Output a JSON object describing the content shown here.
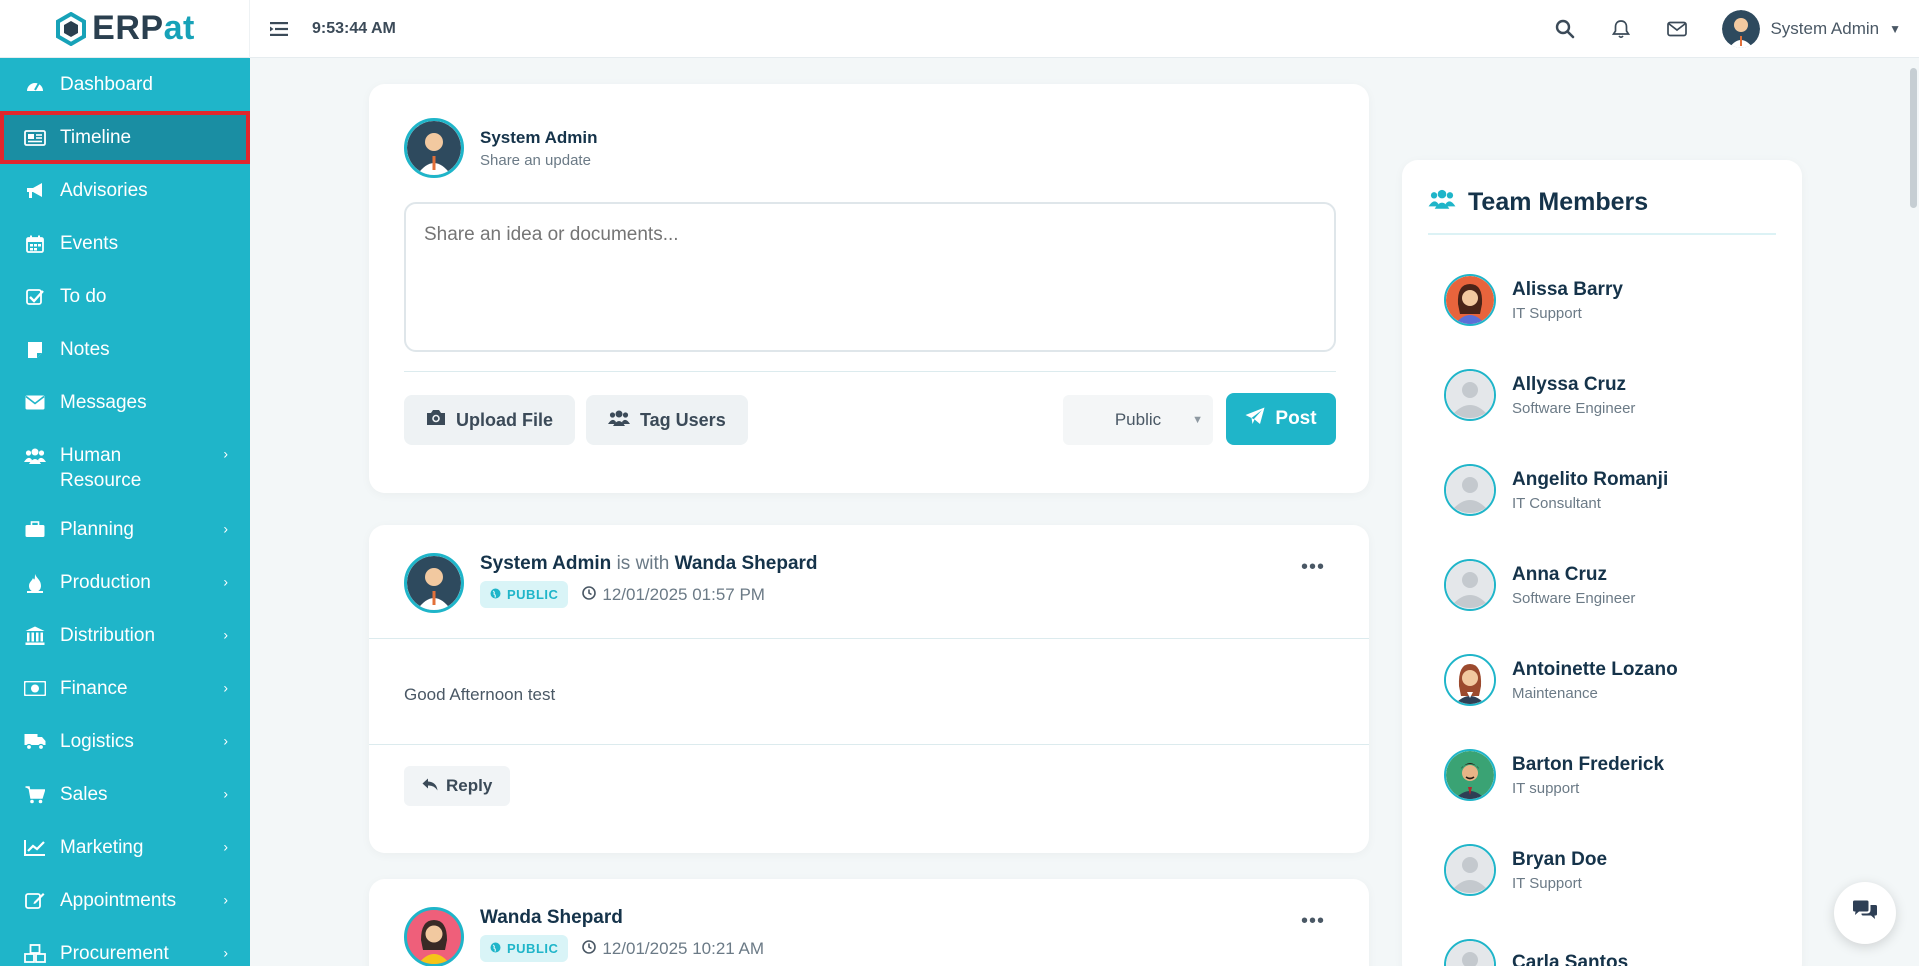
{
  "brand": {
    "prefix": "ERP",
    "suffix": "at"
  },
  "header": {
    "clock": "9:53:44 AM",
    "user_name": "System Admin"
  },
  "sidebar": {
    "items": [
      {
        "label": "Dashboard",
        "icon": "dashboard-icon",
        "has_submenu": false
      },
      {
        "label": "Timeline",
        "icon": "timeline-icon",
        "has_submenu": false,
        "active": true
      },
      {
        "label": "Advisories",
        "icon": "bullhorn-icon",
        "has_submenu": false
      },
      {
        "label": "Events",
        "icon": "calendar-icon",
        "has_submenu": false
      },
      {
        "label": "To do",
        "icon": "check-square-icon",
        "has_submenu": false
      },
      {
        "label": "Notes",
        "icon": "note-icon",
        "has_submenu": false
      },
      {
        "label": "Messages",
        "icon": "envelope-icon",
        "has_submenu": false
      },
      {
        "label": "Human Resource",
        "icon": "users-icon",
        "has_submenu": true
      },
      {
        "label": "Planning",
        "icon": "briefcase-icon",
        "has_submenu": true
      },
      {
        "label": "Production",
        "icon": "fire-icon",
        "has_submenu": true
      },
      {
        "label": "Distribution",
        "icon": "bank-icon",
        "has_submenu": true
      },
      {
        "label": "Finance",
        "icon": "money-icon",
        "has_submenu": true
      },
      {
        "label": "Logistics",
        "icon": "truck-icon",
        "has_submenu": true
      },
      {
        "label": "Sales",
        "icon": "cart-icon",
        "has_submenu": true
      },
      {
        "label": "Marketing",
        "icon": "line-chart-icon",
        "has_submenu": true
      },
      {
        "label": "Appointments",
        "icon": "edit-icon",
        "has_submenu": true
      },
      {
        "label": "Procurement",
        "icon": "cubes-icon",
        "has_submenu": true
      }
    ]
  },
  "composer": {
    "user_name": "System Admin",
    "subtitle": "Share an update",
    "placeholder": "Share an idea or documents...",
    "upload_label": "Upload File",
    "tag_label": "Tag Users",
    "privacy_value": "Public",
    "post_label": "Post"
  },
  "posts": [
    {
      "author": "System Admin",
      "with_text": "is with",
      "with_user": "Wanda Shepard",
      "visibility": "PUBLIC",
      "timestamp": "12/01/2025 01:57 PM",
      "body": "Good Afternoon test",
      "reply_label": "Reply"
    },
    {
      "author": "Wanda Shepard",
      "visibility": "PUBLIC",
      "timestamp": "12/01/2025 10:21 AM"
    }
  ],
  "team": {
    "title": "Team Members",
    "members": [
      {
        "name": "Alissa Barry",
        "role": "IT Support",
        "avatar": "female-avatar-icon"
      },
      {
        "name": "Allyssa Cruz",
        "role": "Software Engineer",
        "avatar": "default-avatar-icon"
      },
      {
        "name": "Angelito Romanji",
        "role": "IT Consultant",
        "avatar": "default-avatar-icon"
      },
      {
        "name": "Anna Cruz",
        "role": "Software Engineer",
        "avatar": "default-avatar-icon"
      },
      {
        "name": "Antoinette Lozano",
        "role": "Maintenance",
        "avatar": "female-avatar-icon"
      },
      {
        "name": "Barton Frederick",
        "role": "IT support",
        "avatar": "male-avatar-icon"
      },
      {
        "name": "Bryan Doe",
        "role": "IT Support",
        "avatar": "default-avatar-icon"
      },
      {
        "name": "Carla Santos",
        "role": "",
        "avatar": "default-avatar-icon"
      }
    ]
  },
  "colors": {
    "accent": "#1fb5c9",
    "active_bg": "#1a8ea3",
    "highlight": "#e1262d"
  }
}
